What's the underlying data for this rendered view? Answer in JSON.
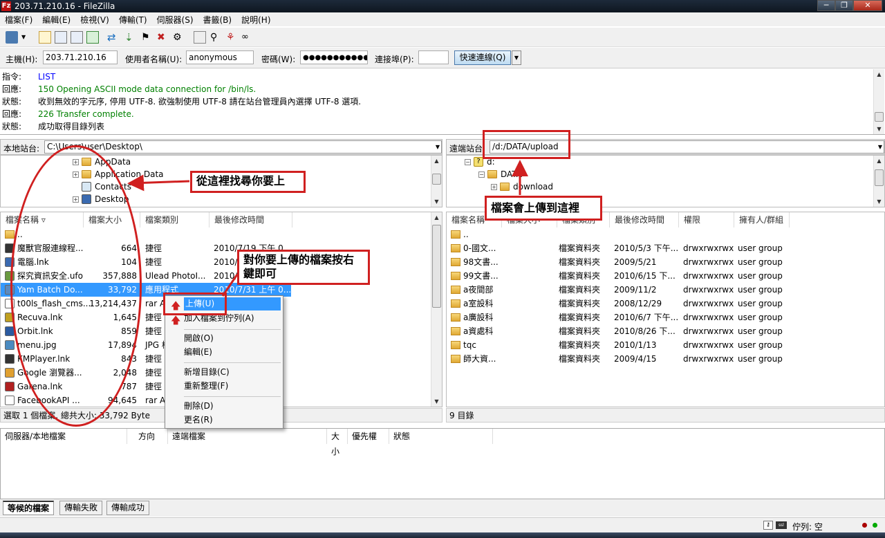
{
  "window": {
    "title": "203.71.210.16 - FileZilla",
    "app_icon": "Fz"
  },
  "menu": [
    "檔案(F)",
    "編輯(E)",
    "檢視(V)",
    "傳輸(T)",
    "伺服器(S)",
    "書籤(B)",
    "說明(H)"
  ],
  "quickconnect": {
    "host_label": "主機(H):",
    "host": "203.71.210.16",
    "user_label": "使用者名稱(U):",
    "user": "anonymous",
    "pass_label": "密碼(W):",
    "pass": "●●●●●●●●●●●●●",
    "port_label": "連接埠(P):",
    "port": "",
    "button": "快速連線(Q)"
  },
  "log": [
    {
      "k": "指令:",
      "v": "LIST",
      "color": "blue"
    },
    {
      "k": "回應:",
      "v": "150 Opening ASCII mode data connection for /bin/ls.",
      "color": "green"
    },
    {
      "k": "狀態:",
      "v": "收到無效的字元序, 停用 UTF-8. 欲強制使用 UTF-8 請在站台管理員內選擇 UTF-8 選項.",
      "color": "black"
    },
    {
      "k": "回應:",
      "v": "226 Transfer complete.",
      "color": "green"
    },
    {
      "k": "狀態:",
      "v": "成功取得目錄列表",
      "color": "black"
    }
  ],
  "local": {
    "site_label": "本地站台:",
    "path": "C:\\Users\\user\\Desktop\\",
    "tree": [
      "AppData",
      "Application Data",
      "Contacts",
      "Desktop"
    ],
    "headers": [
      "檔案名稱",
      "檔案大小",
      "檔案類別",
      "最後修改時間"
    ],
    "files": [
      {
        "name": "..",
        "size": "",
        "type": "",
        "date": ""
      },
      {
        "name": "魔獸官服連線程...",
        "size": "664",
        "type": "捷徑",
        "date": "2010/7/19 下午 0..."
      },
      {
        "name": "電腦.lnk",
        "size": "104",
        "type": "捷徑",
        "date": "2010/..."
      },
      {
        "name": "探究資訊安全.ufo",
        "size": "357,888",
        "type": "Ulead PhotoI...",
        "date": "2010/..."
      },
      {
        "name": "Yam Batch Do...",
        "size": "33,792",
        "type": "應用程式",
        "date": "2010/7/31 上午 0..."
      },
      {
        "name": "t00ls_flash_cms....",
        "size": "13,214,437",
        "type": "rar A",
        "date": ""
      },
      {
        "name": "Recuva.lnk",
        "size": "1,645",
        "type": "捷徑",
        "date": ""
      },
      {
        "name": "Orbit.lnk",
        "size": "859",
        "type": "捷徑",
        "date": ""
      },
      {
        "name": "menu.jpg",
        "size": "17,894",
        "type": "JPG 檔",
        "date": ""
      },
      {
        "name": "KMPlayer.lnk",
        "size": "843",
        "type": "捷徑",
        "date": ""
      },
      {
        "name": "Google 瀏覽器...",
        "size": "2,048",
        "type": "捷徑",
        "date": ""
      },
      {
        "name": "Garena.lnk",
        "size": "787",
        "type": "捷徑",
        "date": ""
      },
      {
        "name": "FacebookAPI ...",
        "size": "94,645",
        "type": "rar Ar",
        "date": ""
      }
    ],
    "status": "選取 1 個檔案. 總共大小: 33,792 Byte"
  },
  "remote": {
    "site_label": "遠端站台:",
    "path": "/d:/DATA/upload",
    "tree": [
      "d:",
      "DATA",
      "download"
    ],
    "headers": [
      "檔案名稱",
      "檔案大小",
      "檔案類別",
      "最後修改時間",
      "權限",
      "擁有人/群組"
    ],
    "files": [
      {
        "name": "..",
        "type": "",
        "date": "",
        "perm": "",
        "owner": ""
      },
      {
        "name": "0-國文...",
        "type": "檔案資料夾",
        "date": "2010/5/3 下午...",
        "perm": "drwxrwxrwx",
        "owner": "user group"
      },
      {
        "name": "98文書...",
        "type": "檔案資料夾",
        "date": "2009/5/21",
        "perm": "drwxrwxrwx",
        "owner": "user group"
      },
      {
        "name": "99文書...",
        "type": "檔案資料夾",
        "date": "2010/6/15 下...",
        "perm": "drwxrwxrwx",
        "owner": "user group"
      },
      {
        "name": "a夜間部",
        "type": "檔案資料夾",
        "date": "2009/11/2",
        "perm": "drwxrwxrwx",
        "owner": "user group"
      },
      {
        "name": "a室設科",
        "type": "檔案資料夾",
        "date": "2008/12/29",
        "perm": "drwxrwxrwx",
        "owner": "user group"
      },
      {
        "name": "a廣設科",
        "type": "檔案資料夾",
        "date": "2010/6/7 下午...",
        "perm": "drwxrwxrwx",
        "owner": "user group"
      },
      {
        "name": "a資處科",
        "type": "檔案資料夾",
        "date": "2010/8/26 下...",
        "perm": "drwxrwxrwx",
        "owner": "user group"
      },
      {
        "name": "tqc",
        "type": "檔案資料夾",
        "date": "2010/1/13",
        "perm": "drwxrwxrwx",
        "owner": "user group"
      },
      {
        "name": "師大資...",
        "type": "檔案資料夾",
        "date": "2009/4/15",
        "perm": "drwxrwxrwx",
        "owner": "user group"
      }
    ],
    "status": "9 目錄"
  },
  "context_menu": [
    "上傳(U)",
    "加入檔案到佇列(A)",
    "開啟(O)",
    "編輯(E)",
    "新增目錄(C)",
    "重新整理(F)",
    "刪除(D)",
    "更名(R)"
  ],
  "queue": {
    "headers": [
      "伺服器/本地檔案",
      "方向",
      "遠端檔案",
      "大小",
      "優先權",
      "狀態"
    ]
  },
  "tabs": [
    "等候的檔案",
    "傳輸失敗",
    "傳輸成功"
  ],
  "bottom_status": {
    "queue": "佇列: 空"
  },
  "annotations": {
    "local": "從這裡找尋你要上",
    "right_click": "對你要上傳的檔案按右鍵即可",
    "remote": "檔案會上傳到這裡"
  }
}
